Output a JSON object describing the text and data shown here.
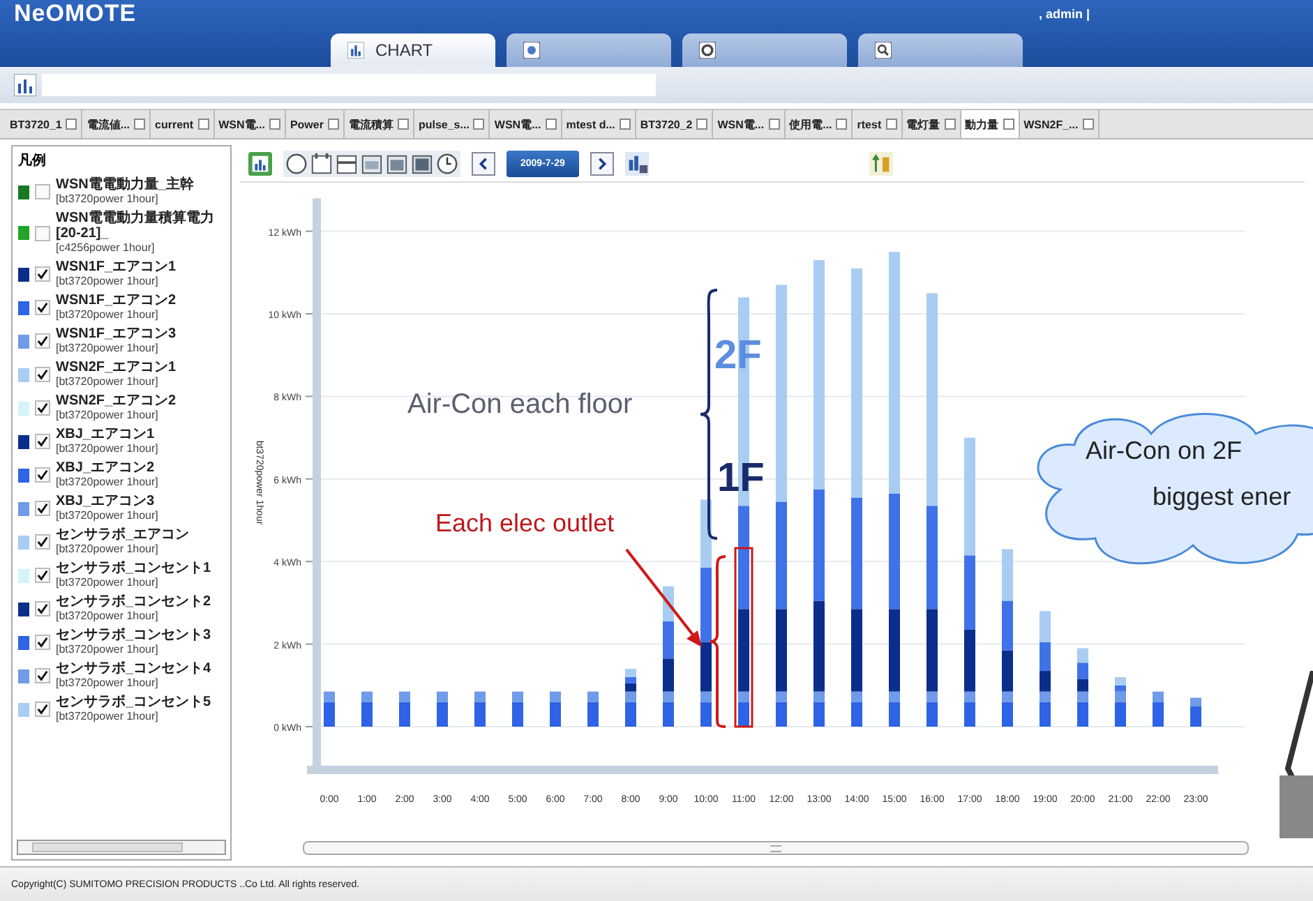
{
  "header": {
    "logo": "NeOMOTE",
    "user": ", admin  |"
  },
  "main_tabs": [
    {
      "label": "CHART",
      "selected": true
    },
    {
      "selected": false
    },
    {
      "selected": false
    },
    {
      "selected": false
    }
  ],
  "doc_tabs": [
    {
      "label": "BT3720_1",
      "selected": false
    },
    {
      "label": "電流値...",
      "selected": false
    },
    {
      "label": "current",
      "selected": false
    },
    {
      "label": "WSN電...",
      "selected": false
    },
    {
      "label": "Power",
      "selected": false
    },
    {
      "label": "電流積算",
      "selected": false
    },
    {
      "label": "pulse_s...",
      "selected": false
    },
    {
      "label": "WSN電...",
      "selected": false
    },
    {
      "label": "mtest d...",
      "selected": false
    },
    {
      "label": "BT3720_2",
      "selected": false
    },
    {
      "label": "WSN電...",
      "selected": false
    },
    {
      "label": "使用電...",
      "selected": false
    },
    {
      "label": "rtest",
      "selected": false
    },
    {
      "label": "電灯量",
      "selected": false
    },
    {
      "label": "動力量",
      "selected": true
    },
    {
      "label": "WSN2F_...",
      "selected": false
    }
  ],
  "legend": {
    "title": "凡例",
    "items": [
      {
        "name": "WSN電電動力量_主幹",
        "unit": "[bt3720power 1hour]",
        "color": "#157a23",
        "checked": false
      },
      {
        "name": "WSN電電動力量積算電力[20-21]_",
        "unit": "[c4256power 1hour]",
        "color": "#22a32a",
        "checked": false
      },
      {
        "name": "WSN1F_エアコン1",
        "unit": "[bt3720power 1hour]",
        "color": "#0b2e8c",
        "checked": true
      },
      {
        "name": "WSN1F_エアコン2",
        "unit": "[bt3720power 1hour]",
        "color": "#2e63e6",
        "checked": true
      },
      {
        "name": "WSN1F_エアコン3",
        "unit": "[bt3720power 1hour]",
        "color": "#6f9be8",
        "checked": true
      },
      {
        "name": "WSN2F_エアコン1",
        "unit": "[bt3720power 1hour]",
        "color": "#a9ccf3",
        "checked": true
      },
      {
        "name": "WSN2F_エアコン2",
        "unit": "[bt3720power 1hour]",
        "color": "#d4f4f8",
        "checked": true
      },
      {
        "name": "XBJ_エアコン1",
        "unit": "[bt3720power 1hour]",
        "color": "#0b2e8c",
        "checked": true
      },
      {
        "name": "XBJ_エアコン2",
        "unit": "[bt3720power 1hour]",
        "color": "#2e63e6",
        "checked": true
      },
      {
        "name": "XBJ_エアコン3",
        "unit": "[bt3720power 1hour]",
        "color": "#6f9be8",
        "checked": true
      },
      {
        "name": "センサラボ_エアコン",
        "unit": "[bt3720power 1hour]",
        "color": "#a9ccf3",
        "checked": true
      },
      {
        "name": "センサラボ_コンセント1",
        "unit": "[bt3720power 1hour]",
        "color": "#d4f4f8",
        "checked": true
      },
      {
        "name": "センサラボ_コンセント2",
        "unit": "[bt3720power 1hour]",
        "color": "#0b2e8c",
        "checked": true
      },
      {
        "name": "センサラボ_コンセント3",
        "unit": "[bt3720power 1hour]",
        "color": "#2e63e6",
        "checked": true
      },
      {
        "name": "センサラボ_コンセント4",
        "unit": "[bt3720power 1hour]",
        "color": "#6f9be8",
        "checked": true
      },
      {
        "name": "センサラボ_コンセント5",
        "unit": "[bt3720power 1hour]",
        "color": "#a9ccf3",
        "checked": true
      }
    ]
  },
  "toolbar": {
    "date": "2009-7-29"
  },
  "chart": {
    "chart_data": {
      "type": "bar",
      "stacked": true,
      "grid": true,
      "ylim": [
        0,
        12.8
      ],
      "ylabel": "bt3720power 1hour",
      "categories": [
        "0:00",
        "1:00",
        "2:00",
        "3:00",
        "4:00",
        "5:00",
        "6:00",
        "7:00",
        "8:00",
        "9:00",
        "10:00",
        "11:00",
        "12:00",
        "13:00",
        "14:00",
        "15:00",
        "16:00",
        "17:00",
        "18:00",
        "19:00",
        "20:00",
        "21:00",
        "22:00",
        "23:00"
      ],
      "yticks": [
        {
          "value": 0,
          "label": "0 kWh"
        },
        {
          "value": 2,
          "label": "2 kWh"
        },
        {
          "value": 4,
          "label": "4 kWh"
        },
        {
          "value": 6,
          "label": "6 kWh"
        },
        {
          "value": 8,
          "label": "8 kWh"
        },
        {
          "value": 10,
          "label": "10 kWh"
        },
        {
          "value": 12,
          "label": "12 kWh"
        }
      ],
      "series": [
        {
          "color": "#2e63e6",
          "values": [
            0.6,
            0.6,
            0.6,
            0.6,
            0.6,
            0.6,
            0.6,
            0.6,
            0.6,
            0.6,
            0.6,
            0.6,
            0.6,
            0.6,
            0.6,
            0.6,
            0.6,
            0.6,
            0.6,
            0.6,
            0.6,
            0.6,
            0.6,
            0.5
          ]
        },
        {
          "color": "#6f9be8",
          "values": [
            0.25,
            0.25,
            0.25,
            0.25,
            0.25,
            0.25,
            0.25,
            0.25,
            0.25,
            0.25,
            0.25,
            0.25,
            0.25,
            0.25,
            0.25,
            0.25,
            0.25,
            0.25,
            0.25,
            0.25,
            0.25,
            0.25,
            0.25,
            0.2
          ]
        },
        {
          "color": "#0b2e8c",
          "values": [
            0,
            0,
            0,
            0,
            0,
            0,
            0,
            0,
            0.2,
            0.8,
            1.2,
            2.0,
            2.0,
            2.2,
            2.0,
            2.0,
            2.0,
            1.5,
            1.0,
            0.5,
            0.3,
            0,
            0,
            0
          ]
        },
        {
          "color": "#3f72e8",
          "values": [
            0,
            0,
            0,
            0,
            0,
            0,
            0,
            0,
            0.15,
            0.9,
            1.8,
            2.5,
            2.6,
            2.7,
            2.7,
            2.8,
            2.5,
            1.8,
            1.2,
            0.7,
            0.4,
            0.15,
            0,
            0
          ]
        },
        {
          "color": "#a9ccf3",
          "values": [
            0,
            0,
            0,
            0,
            0,
            0,
            0,
            0,
            0.2,
            0.85,
            1.65,
            5.05,
            5.25,
            5.55,
            5.55,
            5.85,
            5.15,
            2.85,
            1.25,
            0.75,
            0.35,
            0.2,
            0,
            0
          ]
        }
      ]
    }
  },
  "annotations": [
    {
      "kind": "note",
      "text": "Air-Con each floor"
    },
    {
      "kind": "floor_top",
      "text": "2F"
    },
    {
      "kind": "floor_bottom",
      "text": "1F"
    },
    {
      "kind": "warning",
      "text": "Each elec outlet"
    },
    {
      "kind": "cloud",
      "lines": [
        "Air-Con on 2F",
        "biggest ener"
      ]
    }
  ],
  "footer": "Copyright(C) SUMITOMO PRECISION PRODUCTS ..Co Ltd. All rights reserved."
}
